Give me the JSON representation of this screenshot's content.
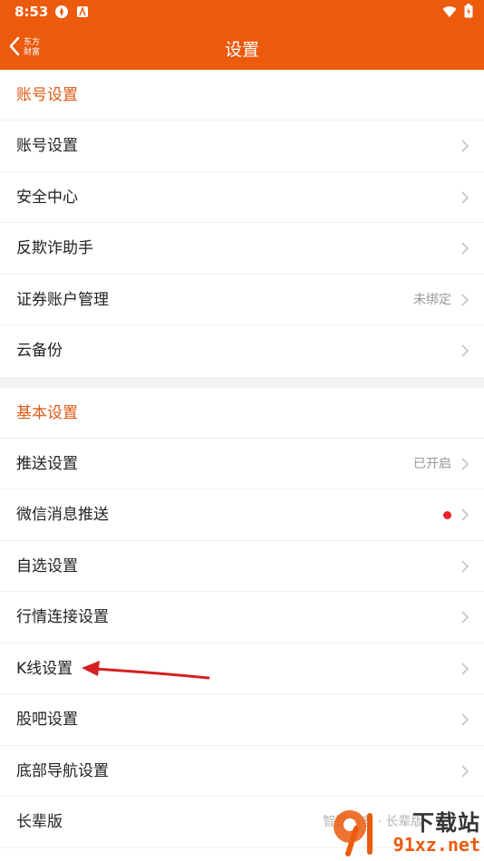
{
  "status": {
    "time": "8:53"
  },
  "nav": {
    "back_logo_line1": "东方",
    "back_logo_line2": "财富",
    "title": "设置"
  },
  "sections": [
    {
      "title": "账号设置",
      "items": [
        {
          "label": "账号设置",
          "value": ""
        },
        {
          "label": "安全中心",
          "value": ""
        },
        {
          "label": "反欺诈助手",
          "value": ""
        },
        {
          "label": "证券账户管理",
          "value": "未绑定"
        },
        {
          "label": "云备份",
          "value": ""
        }
      ]
    },
    {
      "title": "基本设置",
      "items": [
        {
          "label": "推送设置",
          "value": "已开启"
        },
        {
          "label": "微信消息推送",
          "value": ""
        },
        {
          "label": "自选设置",
          "value": ""
        },
        {
          "label": "行情连接设置",
          "value": ""
        },
        {
          "label": "K线设置",
          "value": ""
        },
        {
          "label": "股吧设置",
          "value": ""
        },
        {
          "label": "底部导航设置",
          "value": ""
        },
        {
          "label": "长辈版",
          "value": ""
        }
      ]
    }
  ],
  "watermark": {
    "text": "智慧养老 · 长辈版",
    "brand": "下载站",
    "domain": "91xz.net"
  },
  "colors": {
    "accent": "#ec5a0e",
    "section_title": "#e05a16",
    "badge_dot": "#e8262a",
    "annotation_arrow": "#d42020"
  }
}
